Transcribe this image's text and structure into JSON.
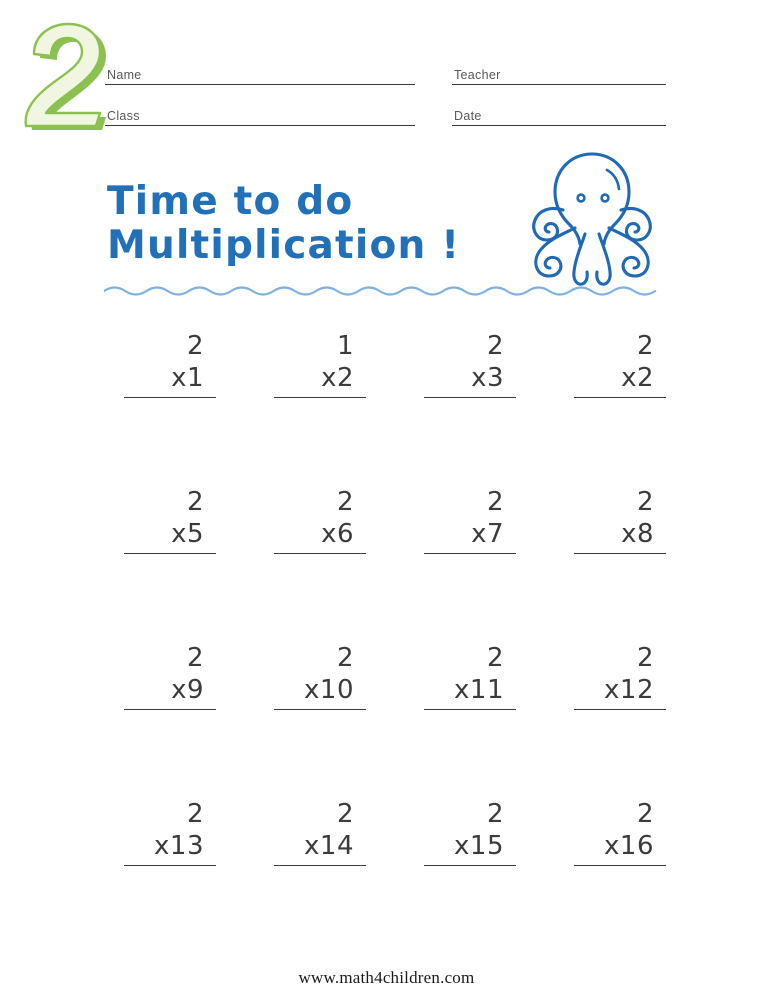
{
  "header": {
    "badge_number": "2",
    "fields": [
      {
        "label": "Name"
      },
      {
        "label": "Class"
      },
      {
        "label": "Teacher"
      },
      {
        "label": "Date"
      }
    ]
  },
  "title": {
    "line1": "Time to do",
    "line2": "Multiplication !"
  },
  "decor": {
    "octopus_icon": "octopus-icon",
    "wave_icon": "wave-divider-icon"
  },
  "colors": {
    "title_blue": "#2170b8",
    "octopus_blue": "#1f69b5",
    "wave_blue": "#7fb0de",
    "badge_fill": "#f1f6e1",
    "badge_shadow": "#8cc152",
    "problem_text": "#3b3b3b",
    "rule": "#3a3a3a"
  },
  "problems": {
    "rows": [
      [
        {
          "top": "2",
          "bottom": "x1"
        },
        {
          "top": "1",
          "bottom": "x2"
        },
        {
          "top": "2",
          "bottom": "x3"
        },
        {
          "top": "2",
          "bottom": "x2"
        }
      ],
      [
        {
          "top": "2",
          "bottom": "x5"
        },
        {
          "top": "2",
          "bottom": "x6"
        },
        {
          "top": "2",
          "bottom": "x7"
        },
        {
          "top": "2",
          "bottom": "x8"
        }
      ],
      [
        {
          "top": "2",
          "bottom": "x9"
        },
        {
          "top": "2",
          "bottom": "x10"
        },
        {
          "top": "2",
          "bottom": "x11"
        },
        {
          "top": "2",
          "bottom": "x12"
        }
      ],
      [
        {
          "top": "2",
          "bottom": "x13"
        },
        {
          "top": "2",
          "bottom": "x14"
        },
        {
          "top": "2",
          "bottom": "x15"
        },
        {
          "top": "2",
          "bottom": "x16"
        }
      ]
    ]
  },
  "footer": {
    "url": "www.math4children.com"
  }
}
